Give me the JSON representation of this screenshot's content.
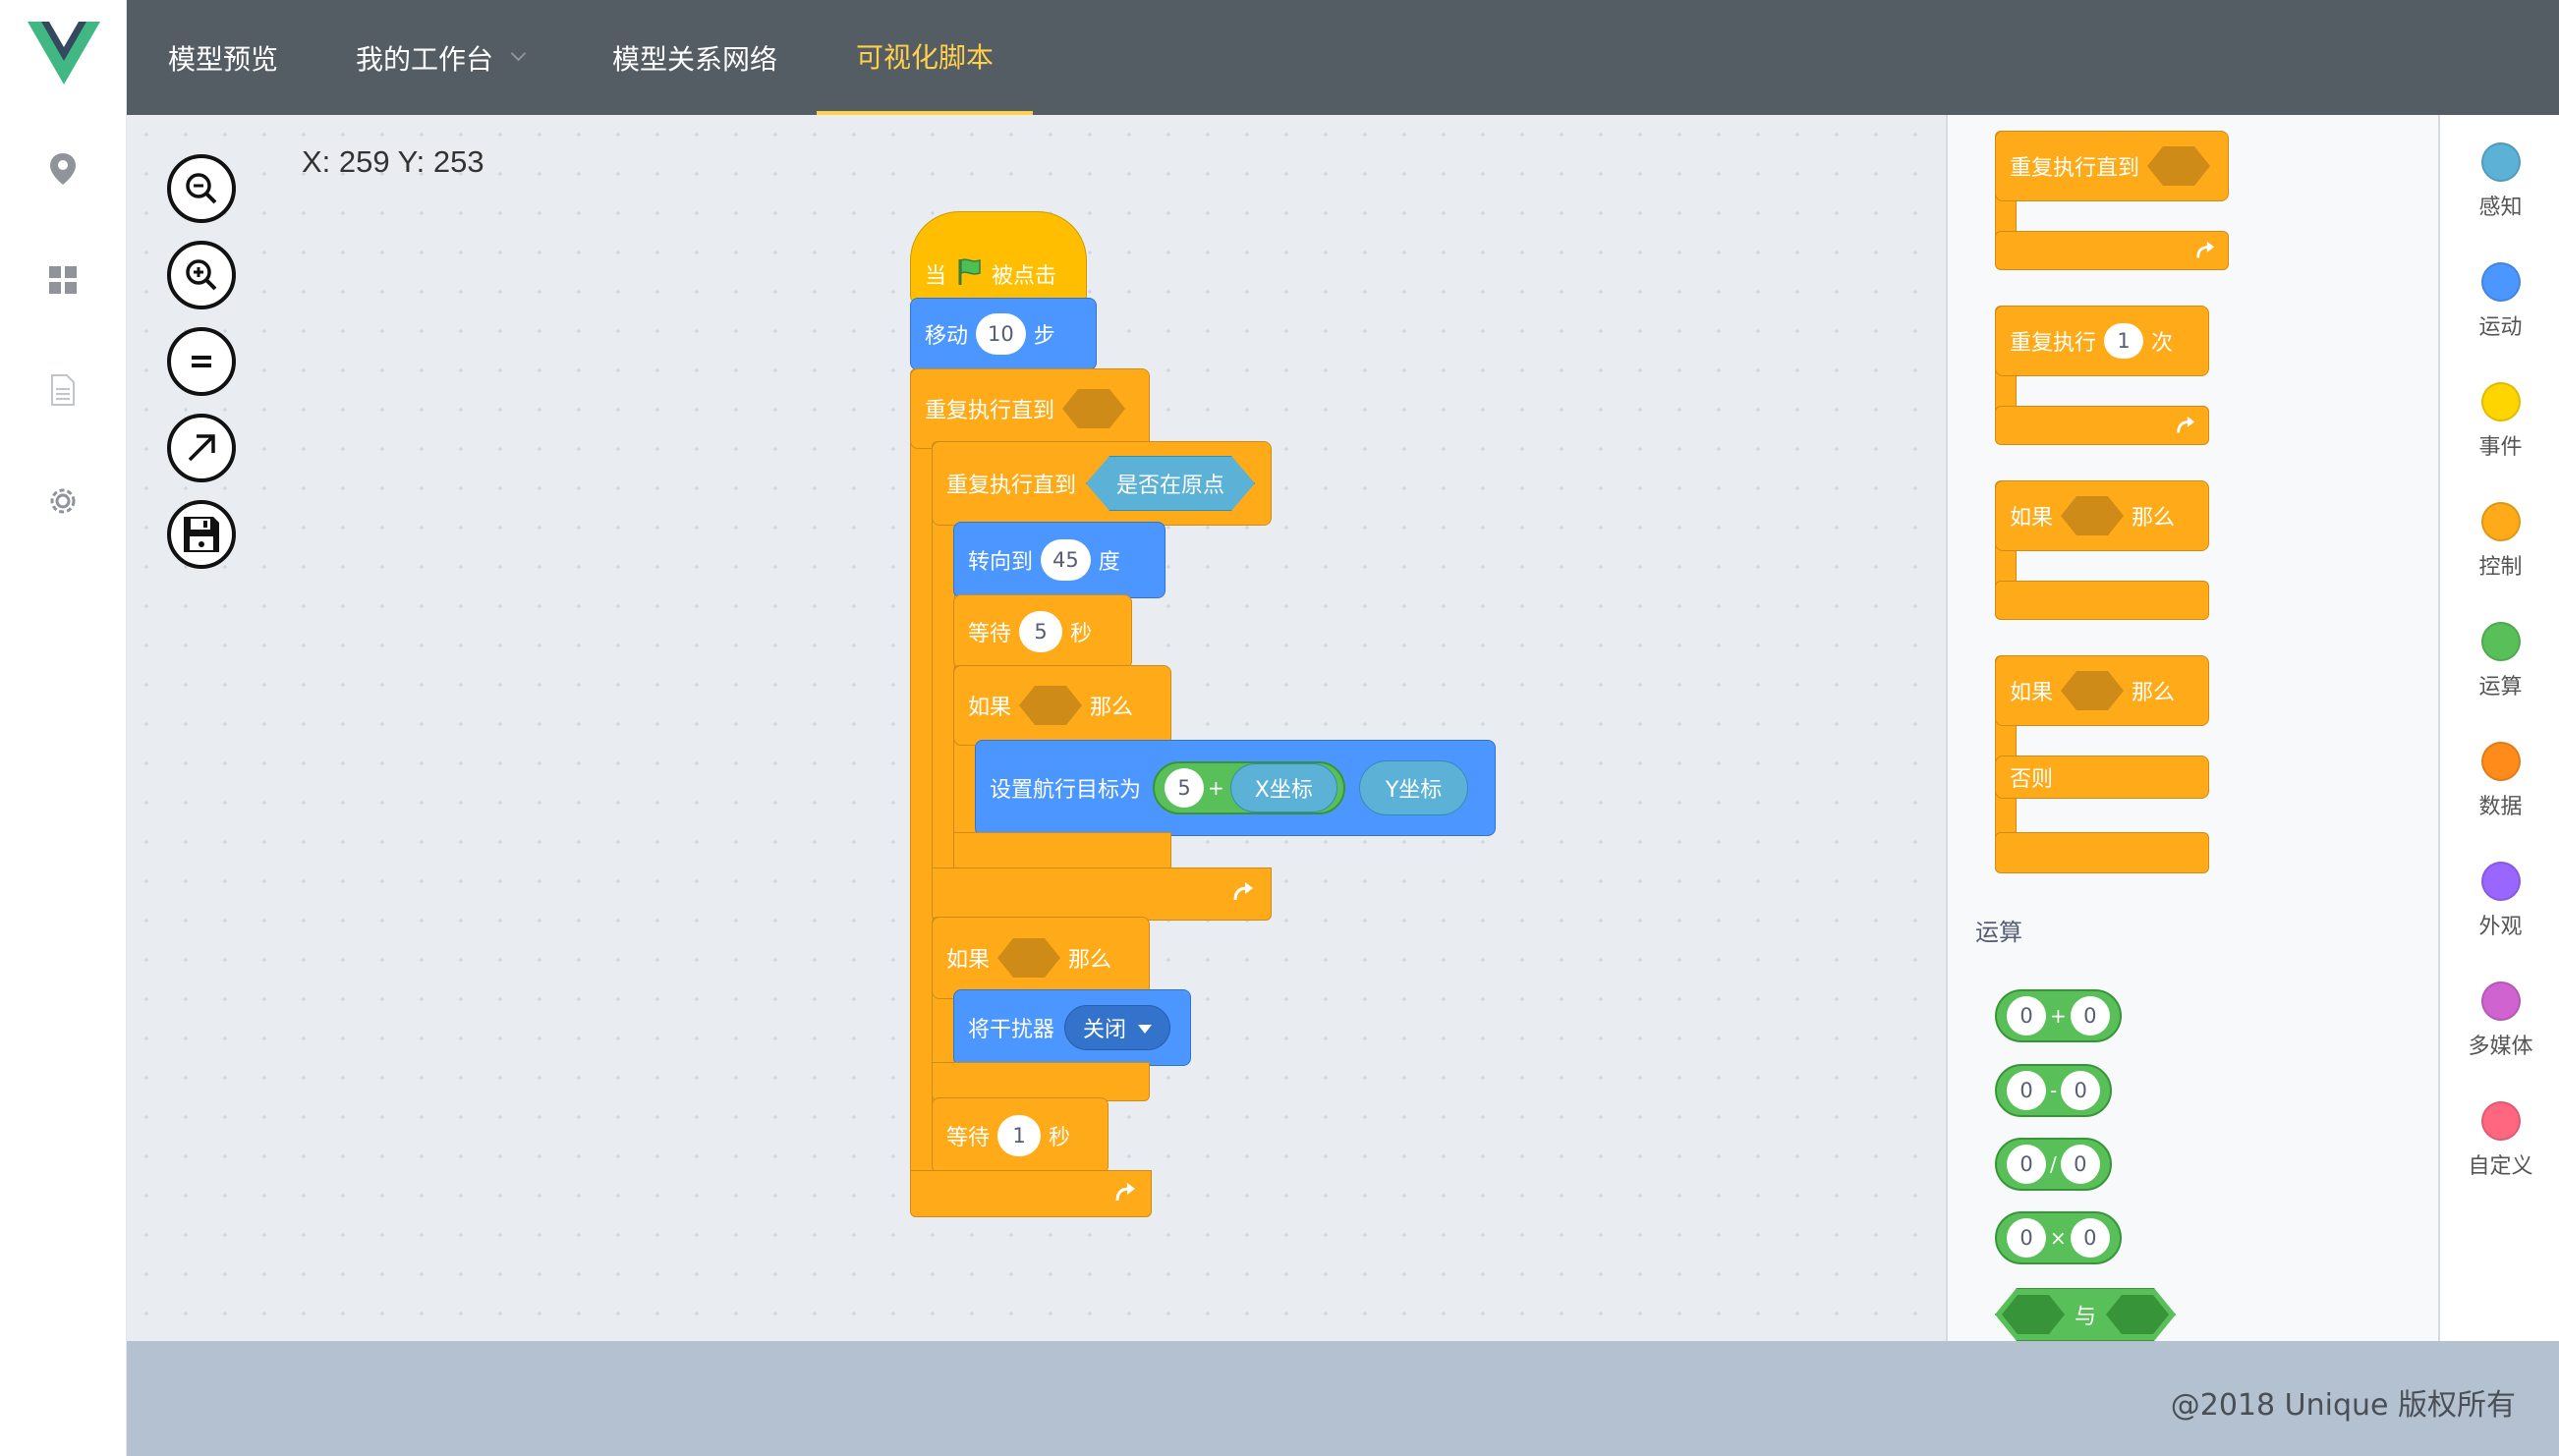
{
  "nav": {
    "items": [
      {
        "label": "模型预览"
      },
      {
        "label": "我的工作台"
      },
      {
        "label": "模型关系网络"
      },
      {
        "label": "可视化脚本"
      }
    ]
  },
  "workspace": {
    "coords": "X: 259 Y: 253"
  },
  "script": {
    "when_flag_1": "当",
    "when_flag_2": "被点击",
    "move_1": "移动",
    "move_val": "10",
    "move_2": "步",
    "repeat_until": "重复执行直到",
    "repeat_until_2": "重复执行直到",
    "at_origin": "是否在原点",
    "point_1": "转向到",
    "point_val": "45",
    "point_2": "度",
    "wait_1": "等待",
    "wait_val": "5",
    "wait_2": "秒",
    "if_1": "如果",
    "if_2": "那么",
    "set_target": "设置航行目标为",
    "set_val": "5",
    "plus": "+",
    "x_coord": "X坐标",
    "y_coord": "Y坐标",
    "if2_1": "如果",
    "if2_2": "那么",
    "jammer": "将干扰器",
    "jammer_val": "关闭",
    "wait2_1": "等待",
    "wait2_val": "1",
    "wait2_2": "秒"
  },
  "palette": {
    "repeat_until": "重复执行直到",
    "repeat_1": "重复执行",
    "repeat_val": "1",
    "repeat_2": "次",
    "if_1": "如果",
    "if_2": "那么",
    "ifelse_1": "如果",
    "ifelse_2": "那么",
    "else": "否则",
    "section": "运算",
    "op_add": {
      "a": "0",
      "op": "+",
      "b": "0"
    },
    "op_sub": {
      "a": "0",
      "op": "-",
      "b": "0"
    },
    "op_div": {
      "a": "0",
      "op": "/",
      "b": "0"
    },
    "op_mul": {
      "a": "0",
      "op": "×",
      "b": "0"
    },
    "and": "与"
  },
  "categories": [
    {
      "label": "感知",
      "color": "#5cb1d6"
    },
    {
      "label": "运动",
      "color": "#4c97ff"
    },
    {
      "label": "事件",
      "color": "#ffd500"
    },
    {
      "label": "控制",
      "color": "#ffab19"
    },
    {
      "label": "运算",
      "color": "#59c059"
    },
    {
      "label": "数据",
      "color": "#ff8c1a"
    },
    {
      "label": "外观",
      "color": "#9966ff"
    },
    {
      "label": "多媒体",
      "color": "#cf63cf"
    },
    {
      "label": "自定义",
      "color": "#ff6680"
    }
  ],
  "footer": "@2018 Unique 版权所有"
}
